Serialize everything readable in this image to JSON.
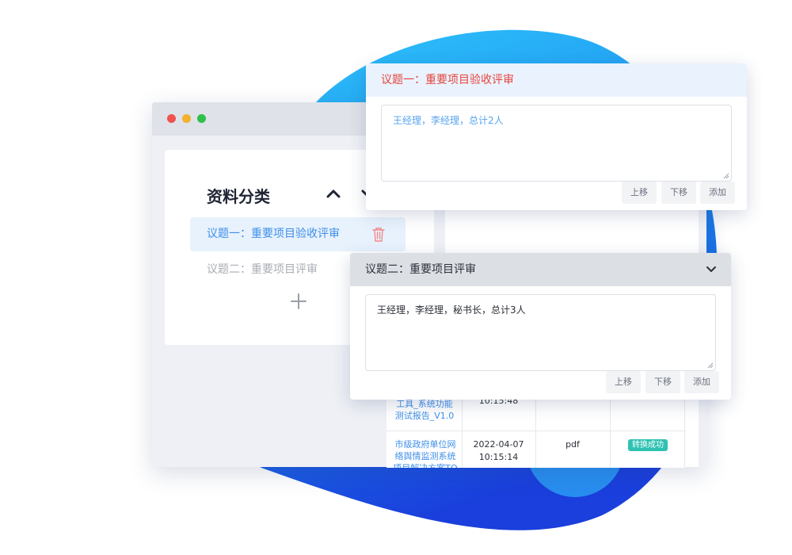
{
  "colors": {
    "accent": "#3f8fe9",
    "red_title": "#e5453d",
    "badge": "#2fc2b2",
    "blob_light": "#2fb8f6",
    "blob_dark": "#1a47e0"
  },
  "sidebar": {
    "title": "资料分类",
    "items": [
      {
        "label": "议题一：重要项目验收评审",
        "active": true
      },
      {
        "label": "议题二：重要项目评审",
        "active": false
      }
    ]
  },
  "table": {
    "row1": {
      "name": "工具_系统功能测试报告_V1.0",
      "time": "10:15:48"
    },
    "row2": {
      "name": "市级政府单位网络舆情监测系统项目解决方案TO深圳",
      "date": "2022-04-07",
      "time": "10:15:14",
      "type": "pdf",
      "status": "转换成功"
    }
  },
  "cards": [
    {
      "title": "议题一：重要项目验收评审",
      "content": "王经理，李经理，总计2人",
      "buttons": [
        "上移",
        "下移",
        "添加"
      ]
    },
    {
      "title": "议题二：重要项目评审",
      "content": "王经理，李经理，秘书长，总计3人",
      "buttons": [
        "上移",
        "下移",
        "添加"
      ]
    }
  ]
}
